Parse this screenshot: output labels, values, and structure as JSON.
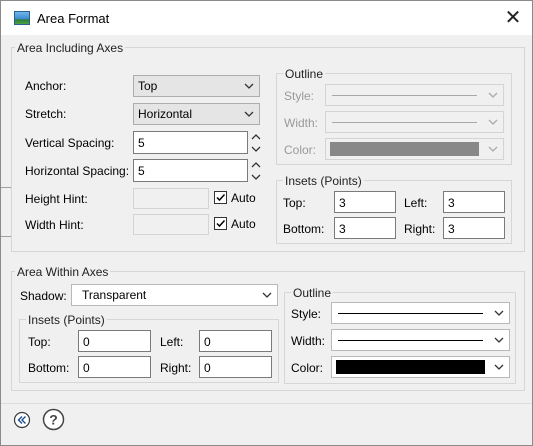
{
  "window": {
    "title": "Area Format",
    "close_glyph": "✕"
  },
  "area_including_axes": {
    "title": "Area Including Axes",
    "anchor_label": "Anchor:",
    "anchor_value": "Top",
    "stretch_label": "Stretch:",
    "stretch_value": "Horizontal",
    "vspacing_label": "Vertical Spacing:",
    "vspacing_value": "5",
    "hspacing_label": "Horizontal Spacing:",
    "hspacing_value": "5",
    "height_hint_label": "Height Hint:",
    "height_auto_label": "Auto",
    "height_auto_checked": true,
    "width_hint_label": "Width Hint:",
    "width_auto_label": "Auto",
    "width_auto_checked": true,
    "outline": {
      "title": "Outline",
      "style_label": "Style:",
      "width_label": "Width:",
      "color_label": "Color:",
      "enabled": false,
      "color": "#888888"
    },
    "insets": {
      "title": "Insets (Points)",
      "top_label": "Top:",
      "top_value": "3",
      "left_label": "Left:",
      "left_value": "3",
      "bottom_label": "Bottom:",
      "bottom_value": "3",
      "right_label": "Right:",
      "right_value": "3"
    }
  },
  "area_within_axes": {
    "title": "Area Within Axes",
    "shadow_label": "Shadow:",
    "shadow_value": "Transparent",
    "insets": {
      "title": "Insets (Points)",
      "top_label": "Top:",
      "top_value": "0",
      "left_label": "Left:",
      "left_value": "0",
      "bottom_label": "Bottom:",
      "bottom_value": "0",
      "right_label": "Right:",
      "right_value": "0"
    },
    "outline": {
      "title": "Outline",
      "style_label": "Style:",
      "width_label": "Width:",
      "color_label": "Color:",
      "enabled": true,
      "color": "#000000"
    }
  },
  "footer": {
    "collapse_icon": "double-chevron-left-icon",
    "help_icon": "help-icon"
  }
}
